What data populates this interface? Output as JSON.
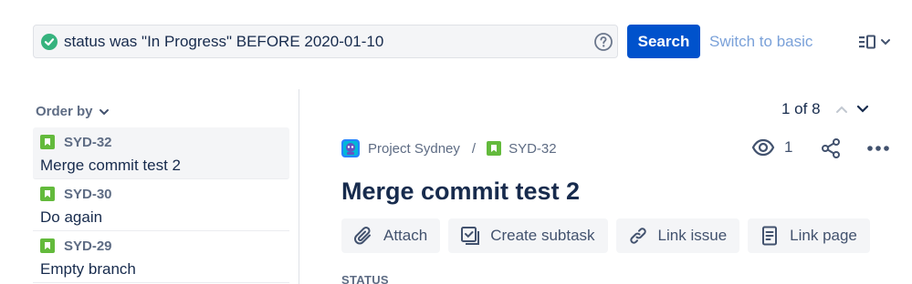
{
  "search": {
    "query": "status was \"In Progress\" BEFORE 2020-01-10",
    "search_label": "Search",
    "switch_label": "Switch to basic"
  },
  "list": {
    "order_by_label": "Order by",
    "items": [
      {
        "key": "SYD-32",
        "summary": "Merge commit test 2",
        "selected": true
      },
      {
        "key": "SYD-30",
        "summary": "Do again",
        "selected": false
      },
      {
        "key": "SYD-29",
        "summary": "Empty branch",
        "selected": false
      }
    ]
  },
  "pager": {
    "text": "1 of 8"
  },
  "issue": {
    "project": "Project Sydney",
    "separator": "/",
    "key": "SYD-32",
    "watchers": "1",
    "title": "Merge commit test 2",
    "actions": {
      "attach": "Attach",
      "subtask": "Create subtask",
      "link_issue": "Link issue",
      "link_page": "Link page"
    },
    "status_label": "STATUS"
  },
  "colors": {
    "primary": "#0052cc",
    "story": "#63ba3c",
    "valid": "#36b37e"
  }
}
